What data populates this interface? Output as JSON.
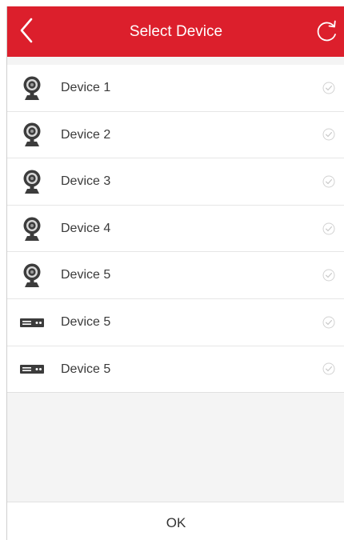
{
  "header": {
    "title": "Select Device",
    "background": "#dc1f2c"
  },
  "devices": [
    {
      "label": "Device 1",
      "icon": "camera-icon",
      "selected": false
    },
    {
      "label": "Device 2",
      "icon": "camera-icon",
      "selected": false
    },
    {
      "label": "Device 3",
      "icon": "camera-icon",
      "selected": false
    },
    {
      "label": "Device 4",
      "icon": "camera-icon",
      "selected": false
    },
    {
      "label": "Device 5",
      "icon": "camera-icon",
      "selected": false
    },
    {
      "label": "Device 5",
      "icon": "nvr-icon",
      "selected": false
    },
    {
      "label": "Device 5",
      "icon": "nvr-icon",
      "selected": false
    }
  ],
  "footer": {
    "ok_label": "OK"
  }
}
